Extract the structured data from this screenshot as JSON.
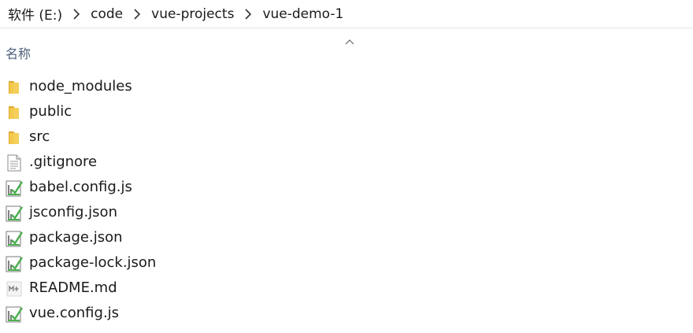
{
  "breadcrumb": {
    "items": [
      {
        "label": "软件 (E:)"
      },
      {
        "label": "code"
      },
      {
        "label": "vue-projects"
      },
      {
        "label": "vue-demo-1"
      }
    ]
  },
  "columns": {
    "name_label": "名称",
    "sort_icon": "chevron-up-icon"
  },
  "files": [
    {
      "name": "node_modules",
      "icon": "folder-icon"
    },
    {
      "name": "public",
      "icon": "folder-icon"
    },
    {
      "name": "src",
      "icon": "folder-icon"
    },
    {
      "name": ".gitignore",
      "icon": "text-file-icon"
    },
    {
      "name": "babel.config.js",
      "icon": "script-file-icon"
    },
    {
      "name": "jsconfig.json",
      "icon": "script-file-icon"
    },
    {
      "name": "package.json",
      "icon": "script-file-icon"
    },
    {
      "name": "package-lock.json",
      "icon": "script-file-icon"
    },
    {
      "name": "README.md",
      "icon": "markdown-file-icon"
    },
    {
      "name": "vue.config.js",
      "icon": "script-file-icon"
    }
  ],
  "colors": {
    "folder": "#f2c94c",
    "folder_dark": "#e0a82e",
    "header_text": "#4c607a",
    "script_green": "#4caf50"
  }
}
